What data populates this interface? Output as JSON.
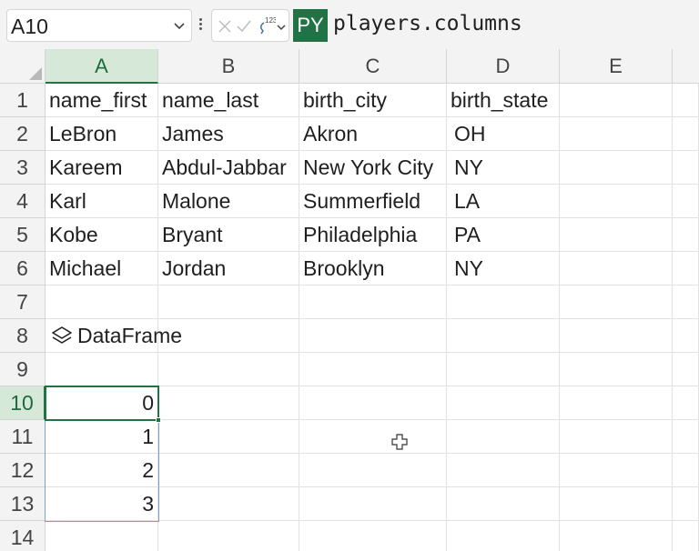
{
  "formula_bar": {
    "name_box": "A10",
    "py_badge": "PY",
    "formula": "players.columns",
    "icons": [
      "chevron-down-icon",
      "more-vertical-icon",
      "cancel-x-icon",
      "confirm-check-icon",
      "python-output-type-icon",
      "chevron-down-icon"
    ]
  },
  "columns": [
    "A",
    "B",
    "C",
    "D",
    "E"
  ],
  "rows": [
    "1",
    "2",
    "3",
    "4",
    "5",
    "6",
    "7",
    "8",
    "9",
    "10",
    "11",
    "12",
    "13",
    "14"
  ],
  "table": {
    "headers": [
      "name_first",
      "name_last",
      "birth_city",
      "birth_state"
    ],
    "records": [
      [
        "LeBron",
        "James",
        "Akron",
        "OH"
      ],
      [
        "Kareem",
        "Abdul-Jabbar",
        "New York City",
        "NY"
      ],
      [
        "Karl",
        "Malone",
        "Summerfield",
        "LA"
      ],
      [
        "Kobe",
        "Bryant",
        "Philadelphia",
        "PA"
      ],
      [
        "Michael",
        "Jordan",
        "Brooklyn",
        "NY"
      ]
    ]
  },
  "dataframe_label": "DataFrame",
  "spill_values": [
    "0",
    "1",
    "2",
    "3"
  ],
  "selected_cell": "A10",
  "colors": {
    "accent": "#217346",
    "selection_header": "#d6e9d9",
    "spill_border": "#7b9fd4"
  }
}
